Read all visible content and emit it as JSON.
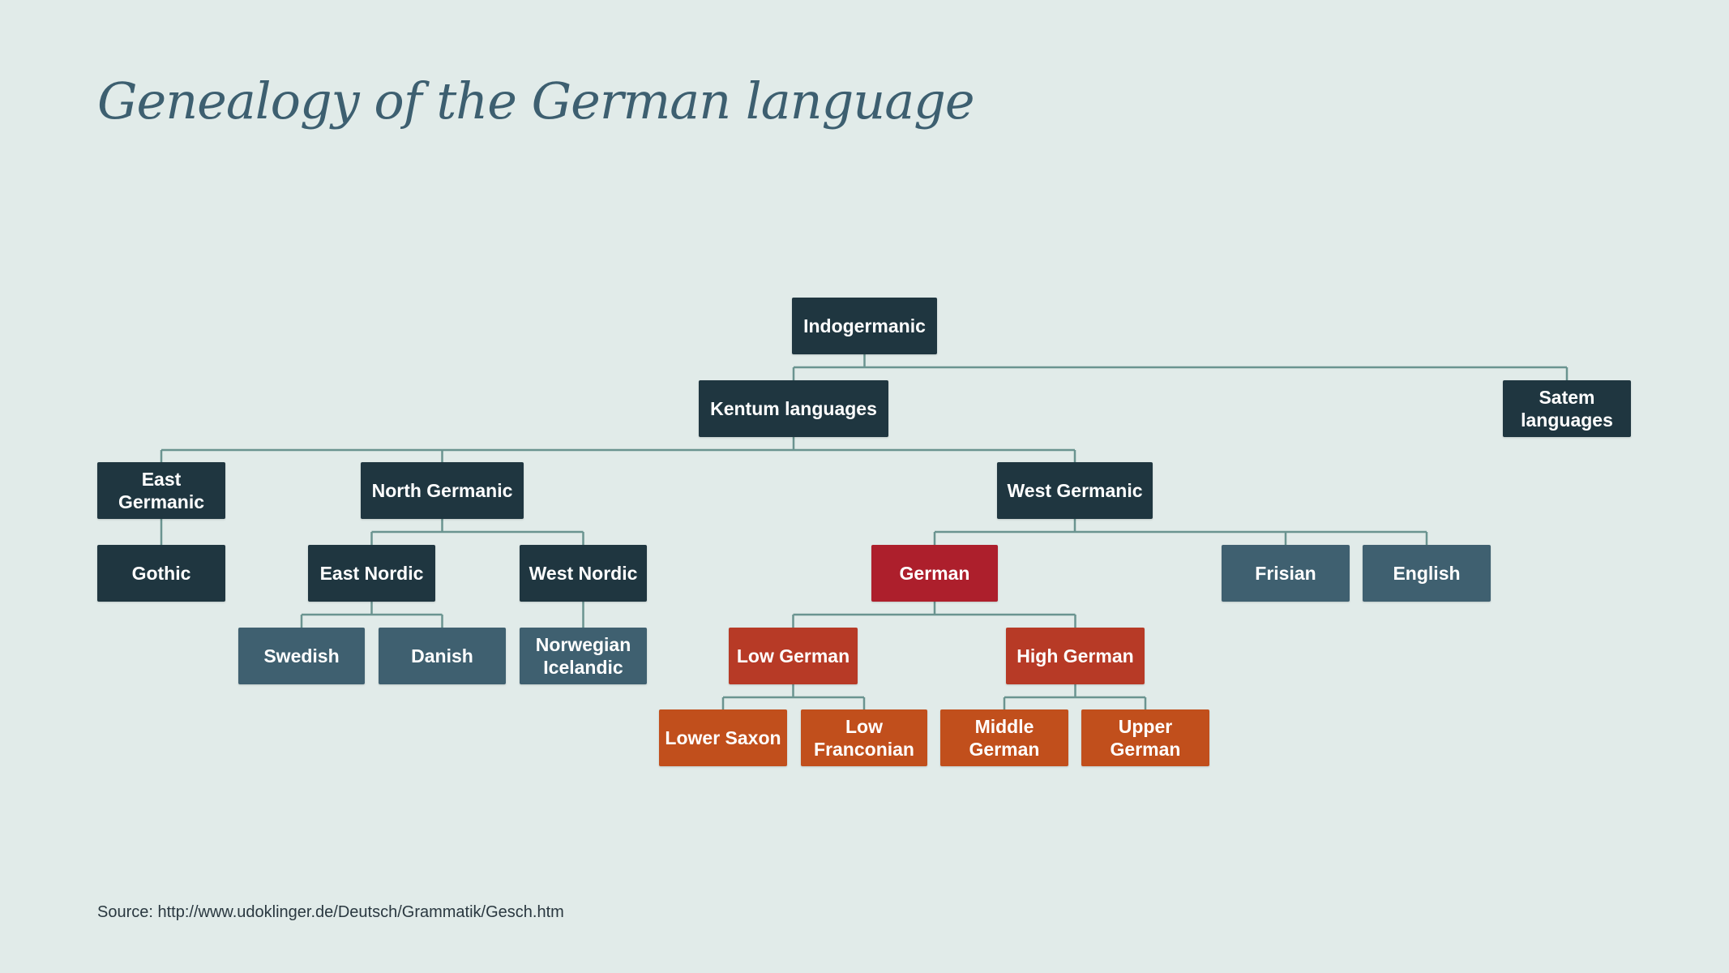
{
  "title": "Genealogy of the German language",
  "source": "Source: http://www.udoklinger.de/Deutsch/Grammatik/Gesch.htm",
  "colors": {
    "background": "#e1ebe9",
    "title": "#3d5f70",
    "connector": "#6a9490",
    "dark_node": "#1f3640",
    "slate_node": "#3f6070",
    "german_node": "#ad1f2c",
    "german_branch_node": "#b73a26",
    "german_dialect_node": "#c14f1c"
  },
  "nodes": {
    "indogermanic": "Indogermanic",
    "kentum": "Kentum languages",
    "satem": "Satem languages",
    "east_germanic": "East Germanic",
    "north_germanic": "North Germanic",
    "west_germanic": "West Germanic",
    "gothic": "Gothic",
    "east_nordic": "East Nordic",
    "west_nordic": "West Nordic",
    "german": "German",
    "frisian": "Frisian",
    "english": "English",
    "swedish": "Swedish",
    "danish": "Danish",
    "norwegian_icelandic": "Norwegian Icelandic",
    "low_german": "Low German",
    "high_german": "High German",
    "lower_saxon": "Lower Saxon",
    "low_franconian": "Low Franconian",
    "middle_german": "Middle German",
    "upper_german": "Upper German"
  },
  "tree": [
    {
      "parent": "indogermanic",
      "children": [
        "kentum",
        "satem"
      ]
    },
    {
      "parent": "kentum",
      "children": [
        "east_germanic",
        "north_germanic",
        "west_germanic"
      ]
    },
    {
      "parent": "east_germanic",
      "children": [
        "gothic"
      ]
    },
    {
      "parent": "north_germanic",
      "children": [
        "east_nordic",
        "west_nordic"
      ]
    },
    {
      "parent": "west_germanic",
      "children": [
        "german",
        "frisian",
        "english"
      ]
    },
    {
      "parent": "east_nordic",
      "children": [
        "swedish",
        "danish"
      ]
    },
    {
      "parent": "west_nordic",
      "children": [
        "norwegian_icelandic"
      ]
    },
    {
      "parent": "german",
      "children": [
        "low_german",
        "high_german"
      ]
    },
    {
      "parent": "low_german",
      "children": [
        "lower_saxon",
        "low_franconian"
      ]
    },
    {
      "parent": "high_german",
      "children": [
        "middle_german",
        "upper_german"
      ]
    }
  ]
}
